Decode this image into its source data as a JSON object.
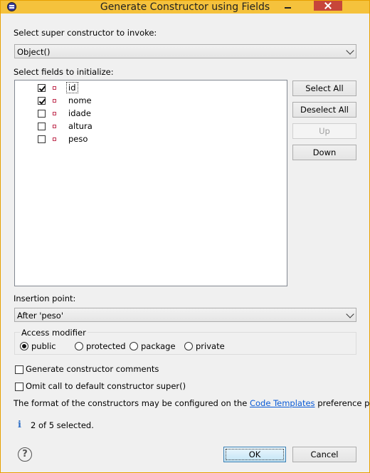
{
  "window": {
    "title": "Generate Constructor using Fields"
  },
  "super_constructor": {
    "label": "Select super constructor to invoke:",
    "value": "Object()"
  },
  "fields": {
    "label": "Select fields to initialize:",
    "items": [
      {
        "name": "id",
        "checked": true
      },
      {
        "name": "nome",
        "checked": true
      },
      {
        "name": "idade",
        "checked": false
      },
      {
        "name": "altura",
        "checked": false
      },
      {
        "name": "peso",
        "checked": false
      }
    ]
  },
  "side_buttons": {
    "select_all": "Select All",
    "deselect_all": "Deselect All",
    "up": "Up",
    "down": "Down"
  },
  "insertion": {
    "label": "Insertion point:",
    "value": "After 'peso'"
  },
  "access": {
    "title": "Access modifier",
    "options": [
      "public",
      "protected",
      "package",
      "private"
    ],
    "selected": "public"
  },
  "options": {
    "generate_comments": {
      "label": "Generate constructor comments",
      "checked": false
    },
    "omit_super": {
      "label": "Omit call to default constructor super()",
      "checked": false
    }
  },
  "format_note": {
    "before": "The format of the constructors may be configured on the ",
    "link": "Code Templates",
    "after": " preference page."
  },
  "status": "2 of 5 selected.",
  "dialog_buttons": {
    "ok": "OK",
    "cancel": "Cancel"
  },
  "icons": {
    "info": "info-icon",
    "help": "help-icon",
    "field": "field-icon"
  }
}
